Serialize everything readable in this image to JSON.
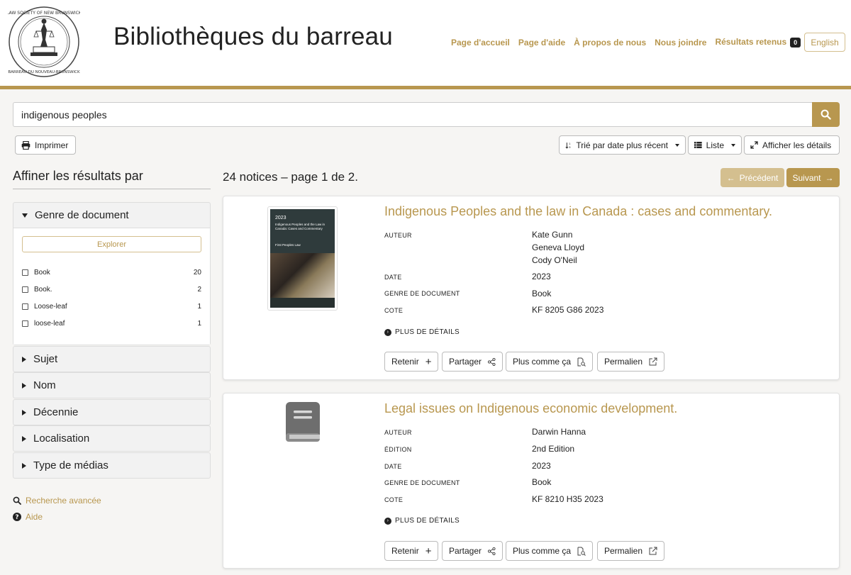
{
  "header": {
    "title": "Bibliothèques du barreau",
    "logo_text": "LAW SOCIETY OF NEW BRUNSWICK · BARREAU DU NOUVEAU-BRUNSWICK",
    "nav": [
      "Page d'accueil",
      "Page d'aide",
      "À propos de nous",
      "Nous joindre"
    ],
    "saved_results_label": "Résultats retenus",
    "saved_results_count": "0",
    "language_button": "English"
  },
  "search": {
    "query": "indigenous peoples"
  },
  "toolbar": {
    "print_label": "Imprimer",
    "sort_label": "Trié par date plus récent",
    "view_label": "Liste",
    "details_label": "Afficher les détails"
  },
  "sidebar": {
    "title": "Affiner les résultats par",
    "open_facet": {
      "label": "Genre de document",
      "explore_label": "Explorer",
      "items": [
        {
          "label": "Book",
          "count": "20"
        },
        {
          "label": "Book.",
          "count": "2"
        },
        {
          "label": "Loose-leaf",
          "count": "1"
        },
        {
          "label": "loose-leaf",
          "count": "1"
        }
      ]
    },
    "collapsed_facets": [
      "Sujet",
      "Nom",
      "Décennie",
      "Localisation",
      "Type de médias"
    ],
    "links": {
      "advanced_search": "Recherche avancée",
      "help": "Aide"
    }
  },
  "results": {
    "summary": "24 notices – page 1 de 2.",
    "prev_label": "Précédent",
    "next_label": "Suivant",
    "more_details_label": "PLUS DE DÉTAILS",
    "actions": {
      "keep": "Retenir",
      "share": "Partager",
      "more_like": "Plus comme ça",
      "permalink": "Permalien"
    },
    "records": [
      {
        "title": "Indigenous Peoples and the law in Canada : cases and commentary.",
        "cover": {
          "year": "2023",
          "text": "Indigenous Peoples and the Law in Canada: Cases and Commentary",
          "sub": "First Peoples Law"
        },
        "fields": [
          {
            "label": "AUTEUR",
            "values": [
              "Kate Gunn",
              "Geneva Lloyd",
              "Cody O'Neil"
            ]
          },
          {
            "label": "DATE",
            "values": [
              "2023"
            ]
          },
          {
            "label": "GENRE DE DOCUMENT",
            "values": [
              "Book"
            ]
          },
          {
            "label": "COTE",
            "values": [
              "KF 8205 G86 2023"
            ]
          }
        ]
      },
      {
        "title": "Legal issues on Indigenous economic development.",
        "fields": [
          {
            "label": "AUTEUR",
            "values": [
              "Darwin Hanna"
            ]
          },
          {
            "label": "ÉDITION",
            "values": [
              "2nd Edition"
            ]
          },
          {
            "label": "DATE",
            "values": [
              "2023"
            ]
          },
          {
            "label": "GENRE DE DOCUMENT",
            "values": [
              "Book"
            ]
          },
          {
            "label": "COTE",
            "values": [
              "KF 8210 H35 2023"
            ]
          }
        ]
      }
    ]
  },
  "colors": {
    "accent": "#b8974f",
    "accent_light": "#d4bf8f"
  }
}
